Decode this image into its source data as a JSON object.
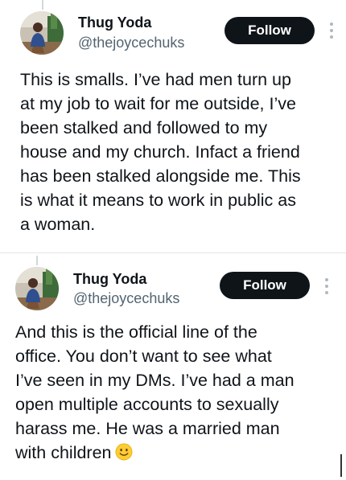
{
  "tweets": [
    {
      "display_name": "Thug Yoda",
      "handle": "@thejoycechuks",
      "follow_label": "Follow",
      "text_lines": [
        "This is smalls. I’ve had men turn up",
        "at my job to wait for me outside, I’ve",
        "been stalked and followed to my",
        "house and my church. Infact a friend",
        "has been stalked alongside me. This",
        "is what it means to work in public as",
        "a woman."
      ]
    },
    {
      "display_name": "Thug Yoda",
      "handle": "@thejoycechuks",
      "follow_label": "Follow",
      "text_lines": [
        "And this is the official line of the",
        "office. You don’t want to see what",
        "I’ve seen in my DMs. I’ve had a man",
        "open multiple accounts to sexually",
        "harass me. He was a married man",
        "with children"
      ],
      "trailing_emoji": "slightly-smiling-face-icon"
    }
  ],
  "colors": {
    "follow_bg": "#0f1419",
    "follow_text": "#ffffff",
    "handle": "#536471",
    "body_text": "#0f1419",
    "emoji_yellow": "#ffcc33"
  }
}
